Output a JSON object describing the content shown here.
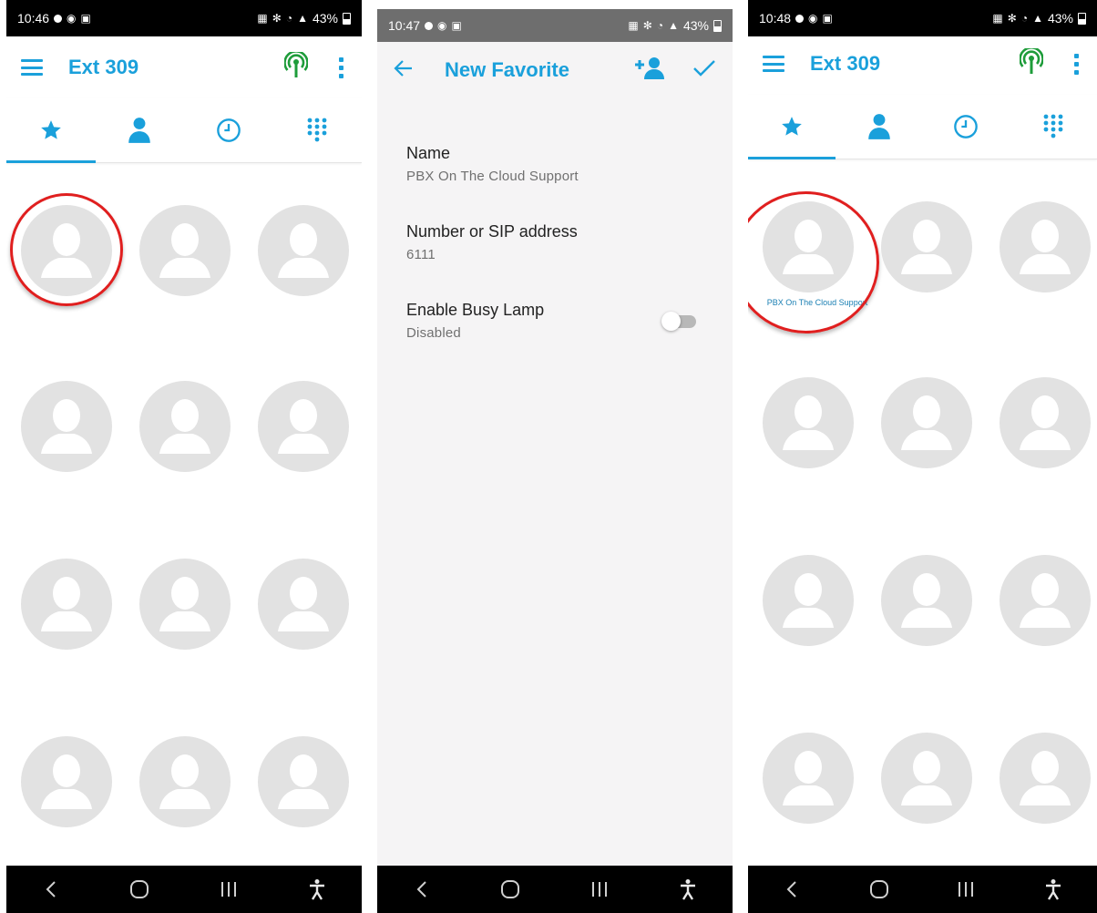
{
  "screens": [
    {
      "status": {
        "time": "10:46",
        "battery": "43%"
      },
      "appbar": {
        "title": "Ext 309"
      },
      "tabs": [
        "favorites",
        "contacts",
        "history",
        "dialpad"
      ],
      "favorites": []
    },
    {
      "status": {
        "time": "10:47",
        "battery": "43%"
      },
      "appbar": {
        "title": "New Favorite"
      },
      "form": {
        "name_label": "Name",
        "name_value": "PBX On The Cloud Support",
        "number_label": "Number or SIP address",
        "number_value": "6111",
        "busy_label": "Enable Busy Lamp",
        "busy_value": "Disabled",
        "busy_enabled": false
      }
    },
    {
      "status": {
        "time": "10:48",
        "battery": "43%"
      },
      "appbar": {
        "title": "Ext 309"
      },
      "tabs": [
        "favorites",
        "contacts",
        "history",
        "dialpad"
      ],
      "favorites": [
        {
          "label": "PBX On The Cloud Support"
        }
      ]
    }
  ],
  "colors": {
    "accent": "#1aa0db",
    "antenna": "#1e9c3a",
    "highlight": "#e01f1f",
    "placeholder": "#e2e2e2"
  },
  "icons": [
    "hamburger-icon",
    "antenna-icon",
    "kebab-icon",
    "star-icon",
    "person-icon",
    "clock-icon",
    "dialpad-icon",
    "back-arrow-icon",
    "add-contact-icon",
    "check-icon"
  ]
}
